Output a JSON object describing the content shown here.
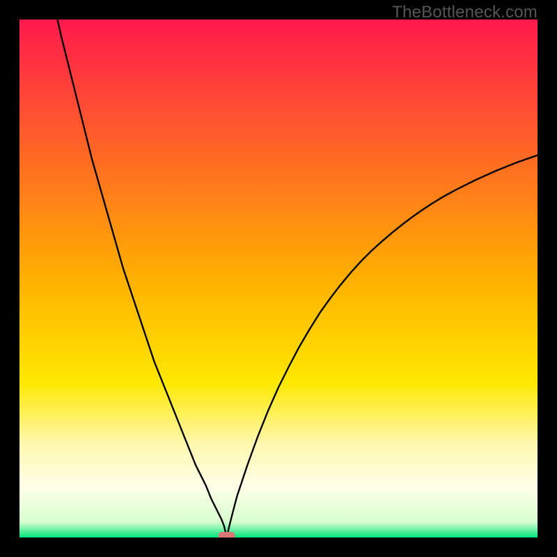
{
  "watermark": "TheBottleneck.com",
  "chart_data": {
    "type": "line",
    "title": "",
    "xlabel": "",
    "ylabel": "",
    "xlim": [
      0,
      100
    ],
    "ylim": [
      0,
      100
    ],
    "minimum_x": 40,
    "gradient_stops": [
      {
        "pos": 0.0,
        "color": "#ff1a4d"
      },
      {
        "pos": 0.5,
        "color": "#ffb000"
      },
      {
        "pos": 0.7,
        "color": "#ffe800"
      },
      {
        "pos": 0.82,
        "color": "#fff8b0"
      },
      {
        "pos": 0.9,
        "color": "#ffffe8"
      },
      {
        "pos": 0.97,
        "color": "#d8ffd0"
      },
      {
        "pos": 1.0,
        "color": "#00e47a"
      }
    ],
    "marker": {
      "x": 40,
      "y": 0,
      "color": "#d97a78"
    },
    "series": [
      {
        "name": "bottleneck-curve",
        "x": [
          0,
          2,
          4,
          6,
          8,
          10,
          12,
          14,
          16,
          18,
          20,
          22,
          24,
          26,
          28,
          30,
          32,
          34,
          36,
          37,
          38,
          39,
          39.5,
          40,
          40.5,
          41,
          42,
          44,
          46,
          48,
          50,
          52,
          54,
          56,
          58,
          60,
          62,
          64,
          66,
          68,
          70,
          72,
          74,
          76,
          78,
          80,
          82,
          84,
          86,
          88,
          90,
          92,
          94,
          96,
          98,
          100
        ],
        "y": [
          135,
          125,
          115,
          106,
          97,
          89,
          81,
          73,
          66,
          59,
          52,
          46,
          40,
          34,
          29,
          24,
          19,
          14,
          10,
          7.5,
          5.5,
          3.5,
          2.2,
          0,
          2.2,
          4.2,
          8,
          14,
          19.5,
          24.5,
          29,
          33,
          36.8,
          40.2,
          43.4,
          46.2,
          48.8,
          51.2,
          53.4,
          55.4,
          57.2,
          58.9,
          60.5,
          62,
          63.4,
          64.7,
          65.9,
          67,
          68,
          69,
          69.9,
          70.8,
          71.6,
          72.4,
          73.1,
          73.8
        ]
      }
    ]
  }
}
